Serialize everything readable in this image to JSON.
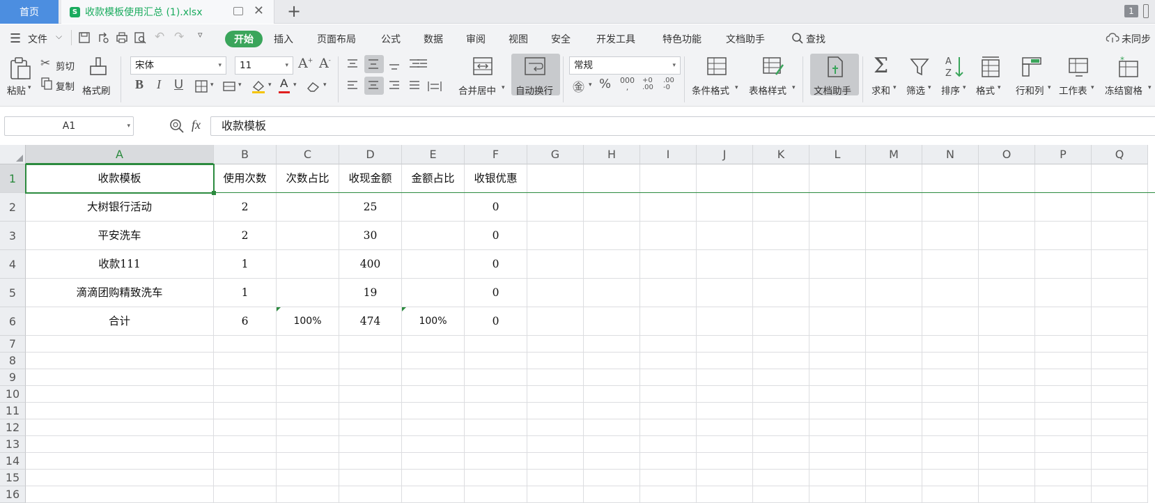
{
  "tabs": {
    "home": "首页",
    "file_icon": "S",
    "file_name": "收款模板使用汇总 (1).xlsx",
    "window_count": "1"
  },
  "menu": {
    "file": "文件",
    "items": [
      "开始",
      "插入",
      "页面布局",
      "公式",
      "数据",
      "审阅",
      "视图",
      "安全",
      "开发工具",
      "特色功能",
      "文档助手"
    ],
    "search": "查找",
    "sync": "未同步"
  },
  "ribbon": {
    "paste": "粘贴",
    "cut": "剪切",
    "copy": "复制",
    "format_painter": "格式刷",
    "font_name": "宋体",
    "font_size": "11",
    "merge_center": "合并居中",
    "auto_wrap": "自动换行",
    "number_format": "常规",
    "conditional_format": "条件格式",
    "table_style": "表格样式",
    "doc_assistant": "文档助手",
    "sum": "求和",
    "filter": "筛选",
    "sort": "排序",
    "format": "格式",
    "row_col": "行和列",
    "worksheet": "工作表",
    "freeze": "冻结窗格"
  },
  "formula_bar": {
    "name_box": "A1",
    "fx": "fx",
    "content": "收款模板"
  },
  "sheet": {
    "columns": [
      "A",
      "B",
      "C",
      "D",
      "E",
      "F",
      "G",
      "H",
      "I",
      "J",
      "K",
      "L",
      "M",
      "N",
      "O",
      "P",
      "Q"
    ],
    "rows": [
      "1",
      "2",
      "3",
      "4",
      "5",
      "6",
      "7",
      "8",
      "9",
      "10",
      "11",
      "12",
      "13",
      "14",
      "15",
      "16"
    ],
    "cells": [
      [
        "收款模板",
        "使用次数",
        "次数占比",
        "收现金额",
        "金额占比",
        "收银优惠"
      ],
      [
        "大树银行活动",
        "2",
        "",
        "25",
        "",
        "0"
      ],
      [
        "平安洗车",
        "2",
        "",
        "30",
        "",
        "0"
      ],
      [
        "收款111",
        "1",
        "",
        "400",
        "",
        "0"
      ],
      [
        "滴滴团购精致洗车",
        "1",
        "",
        "19",
        "",
        "0"
      ],
      [
        "合计",
        "6",
        "100%",
        "474",
        "100%",
        "0"
      ]
    ]
  }
}
